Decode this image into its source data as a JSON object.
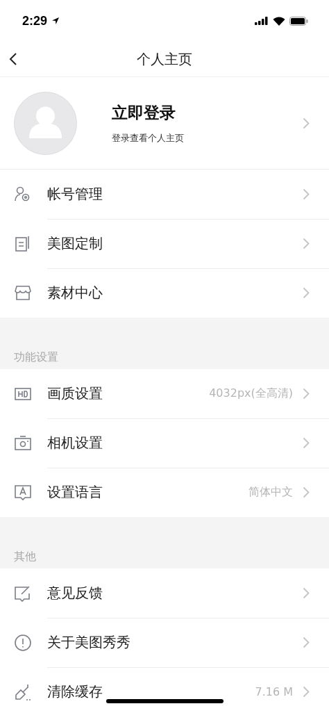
{
  "status_bar": {
    "time": "2:29"
  },
  "nav": {
    "title": "个人主页"
  },
  "profile": {
    "title": "立即登录",
    "subtitle": "登录查看个人主页"
  },
  "sections": [
    {
      "items": [
        {
          "label": "帐号管理"
        },
        {
          "label": "美图定制"
        },
        {
          "label": "素材中心"
        }
      ]
    },
    {
      "header": "功能设置",
      "items": [
        {
          "label": "画质设置",
          "value": "4032px(全高清)"
        },
        {
          "label": "相机设置"
        },
        {
          "label": "设置语言",
          "value": "简体中文"
        }
      ]
    },
    {
      "header": "其他",
      "items": [
        {
          "label": "意见反馈"
        },
        {
          "label": "关于美图秀秀"
        },
        {
          "label": "清除缓存",
          "value": "7.16 M"
        }
      ]
    }
  ]
}
